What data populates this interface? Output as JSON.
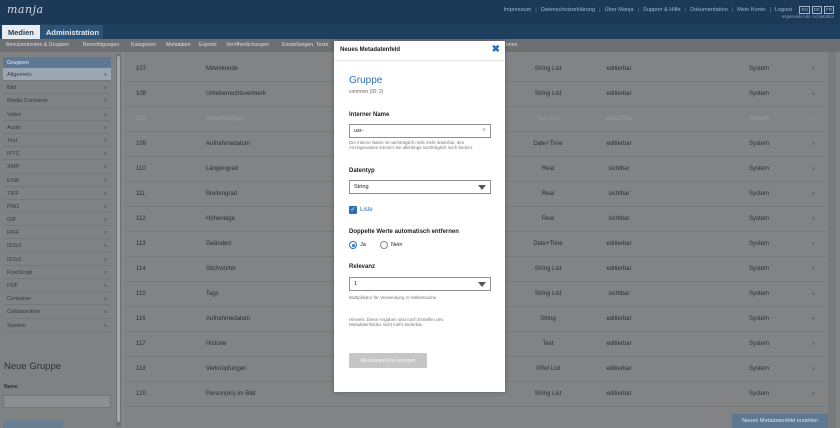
{
  "topbar": {
    "logo": "manja",
    "links": [
      "Impressum",
      "Datenschutzerklärung",
      "Über Manja",
      "Support & Hilfe",
      "Dokumentation",
      "Mein Konto",
      "Logout"
    ],
    "languages": [
      "EN",
      "DE",
      "FR"
    ],
    "user_line": "angemeldet als: AcmeEditor"
  },
  "main_tabs": {
    "medien": "Medien",
    "administration": "Administration"
  },
  "subnav": [
    "Benutzerkonten & Gruppen",
    "Berechtigungen",
    "Kategorien",
    "Metadaten",
    "Exports",
    "Veröffentlichungen",
    "Einstellungen, Texte",
    "onen"
  ],
  "sidebar": {
    "header": "Gruppen",
    "items": [
      "Allgemein",
      "Bild",
      "Media Container",
      "Video",
      "Audio",
      "Text",
      "IPTC",
      "XMP",
      "EXIF",
      "TIFF",
      "PNG",
      "GIF",
      "RIFF",
      "ID3v1",
      "ID3v2",
      "PostScript",
      "PDF",
      "Container",
      "Collaboration",
      "System"
    ],
    "new_group_title": "Neue Gruppe",
    "name_label": "Name"
  },
  "table": {
    "rows": [
      {
        "id": "107",
        "name": "Mitwirkende",
        "type": "String List",
        "visibility": "editierbar",
        "source": "System"
      },
      {
        "id": "108",
        "name": "Urheberrechtsvermerk",
        "type": "String List",
        "visibility": "editierbar",
        "source": "System"
      },
      {
        "id": "110",
        "name": "Anwendungen",
        "type": "Text List",
        "visibility": "unsichtbar",
        "source": "System"
      },
      {
        "id": "109",
        "name": "Aufnahmedatum",
        "type": "Date+Time",
        "visibility": "editierbar",
        "source": "System"
      },
      {
        "id": "110",
        "name": "Längengrad",
        "type": "Real",
        "visibility": "sichtbar",
        "source": "System"
      },
      {
        "id": "111",
        "name": "Breitengrad",
        "type": "Real",
        "visibility": "sichtbar",
        "source": "System"
      },
      {
        "id": "112",
        "name": "Höhenlage",
        "type": "Real",
        "visibility": "sichtbar",
        "source": "System"
      },
      {
        "id": "113",
        "name": "Geändert",
        "type": "Date+Time",
        "visibility": "editierbar",
        "source": "System"
      },
      {
        "id": "114",
        "name": "Stichwörter",
        "type": "String List",
        "visibility": "editierbar",
        "source": "System"
      },
      {
        "id": "115",
        "name": "Tags",
        "type": "String List",
        "visibility": "sichtbar",
        "source": "System"
      },
      {
        "id": "116",
        "name": "Aufnahmedatum",
        "type": "String",
        "visibility": "editierbar",
        "source": "System"
      },
      {
        "id": "117",
        "name": "Historie",
        "type": "Text",
        "visibility": "editierbar",
        "source": "System"
      },
      {
        "id": "118",
        "name": "Verknüpfungen",
        "type": "XRef List",
        "visibility": "editierbar",
        "source": "System"
      },
      {
        "id": "120",
        "name": "Person(en) im Bild",
        "type": "String List",
        "visibility": "editierbar",
        "source": "System"
      }
    ],
    "new_button": "Neues Metadatenfeld erstellen"
  },
  "modal": {
    "title": "Neues Metadatenfeld",
    "group_name": "Gruppe",
    "group_sub": "common (ID: 2)",
    "internal_name_label": "Interner Name",
    "internal_name_value": "usr-",
    "internal_name_hint": "Der interne Name ist nachträglich nicht mehr änderbar, den Anzeigenamen können Sie allerdings nachträglich noch ändern.",
    "datatype_label": "Datentyp",
    "datatype_value": "String",
    "list_label": "Liste",
    "dup_label": "Doppelte Werte automatisch entfernen",
    "dup_yes": "Ja",
    "dup_no": "Nein",
    "relevance_label": "Relevanz",
    "relevance_value": "1",
    "relevance_hint": "Multiplikator für Verwendung in Volltextsuche.",
    "note": "Hinweis: Diese Angaben sind nach Erstellen des Metadatenfeldes nicht mehr änderbar.",
    "submit": "Metadatenfeld anlegen"
  }
}
